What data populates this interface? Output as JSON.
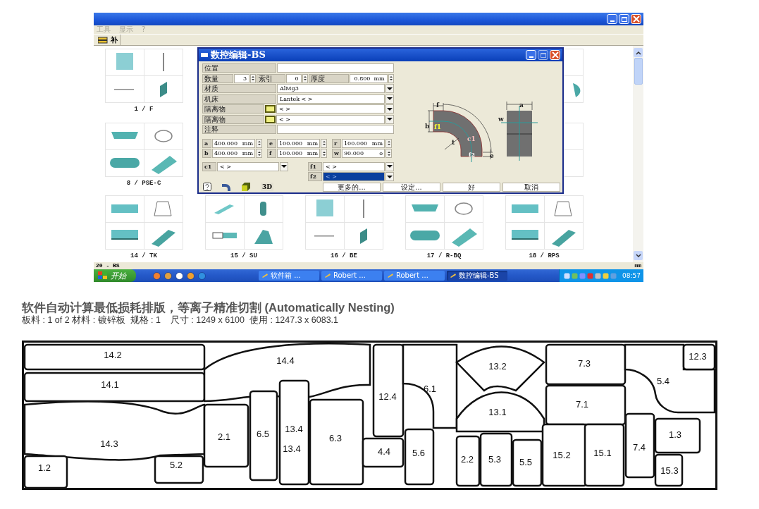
{
  "menu": [
    {
      "label": "工具",
      "disabled": true
    },
    {
      "label": "显示",
      "disabled": true
    },
    {
      "label": "?",
      "disabled": true
    }
  ],
  "toolbar": {
    "label": "补"
  },
  "cards": [
    {
      "label": "1 / F"
    },
    {
      "label": "8 / PSE-C"
    },
    {
      "label": "14 / TK"
    },
    {
      "label": "15 / SU"
    },
    {
      "label": "16 / BE"
    },
    {
      "label": "17 / R-BQ"
    },
    {
      "label": "18 / RPS"
    }
  ],
  "dialog": {
    "title": "数控编辑-BS",
    "rows": [
      {
        "kind": "text",
        "label": "位置"
      },
      {
        "kind": "counts",
        "items": [
          {
            "label": "数量",
            "value": "3"
          },
          {
            "label": "索引",
            "value": "0"
          },
          {
            "label": "厚度",
            "value": "0.800",
            "unit": "mm"
          }
        ]
      },
      {
        "kind": "select",
        "label": "材质",
        "value": "AlMg3"
      },
      {
        "kind": "select",
        "label": "机床",
        "value": "Lantek < >"
      },
      {
        "kind": "swatch",
        "label": "隔离物",
        "value": "< >"
      },
      {
        "kind": "swatch",
        "label": "隔离物",
        "value": "< >"
      },
      {
        "kind": "text",
        "label": "注释"
      }
    ],
    "dims": [
      [
        {
          "label": "a",
          "value": "400.000",
          "unit": "mm"
        },
        {
          "label": "e",
          "value": "100.000",
          "unit": "mm"
        },
        {
          "label": "r",
          "value": "100.000",
          "unit": "mm"
        }
      ],
      [
        {
          "label": "b",
          "value": "400.000",
          "unit": "mm"
        },
        {
          "label": "f",
          "value": "100.000",
          "unit": "mm"
        },
        {
          "label": "w",
          "value": "90.000",
          "unit": "o"
        }
      ]
    ],
    "c_select": {
      "label": "c1",
      "value": "< >"
    },
    "f_selects": [
      {
        "label": "f1",
        "value": "< >",
        "selected": false
      },
      {
        "label": "f2",
        "value": "< >",
        "selected": true
      }
    ],
    "diagram_labels": [
      "f",
      "w",
      "b",
      "f1",
      "c1",
      "t",
      "f2",
      "e",
      "a"
    ],
    "tool_text": "3D",
    "buttons": [
      "更多的...",
      "设定...",
      "好",
      "取消"
    ]
  },
  "status_bar": {
    "left": "20 - BS",
    "right": "mm"
  },
  "taskbar": {
    "start": "开始",
    "tasks": [
      {
        "label": "软件箱 ...",
        "selected": false
      },
      {
        "label": "Robert ...",
        "selected": false
      },
      {
        "label": "Robert ...",
        "selected": false
      },
      {
        "label": "数控编辑-BS",
        "selected": true
      }
    ],
    "clock": "08:57"
  },
  "caption": {
    "title": "软件自动计算最低损耗排版，等离子精准切割 (Automatically Nesting)",
    "subtitle": "板料 : 1 of 2 材料 : 镀锌板  规格 : 1    尺寸 : 1249 x 6100  使用 : 1247.3 x 6083.1"
  },
  "nesting": {
    "parts": [
      "14.2",
      "14.1",
      "14.4",
      "14.3",
      "1.2",
      "5.2",
      "2.1",
      "6.5",
      "13.4",
      "13.4",
      "6.3",
      "12.4",
      "4.4",
      "5.6",
      "6.1",
      "13.2",
      "13.1",
      "2.2",
      "5.3",
      "5.5",
      "7.3",
      "7.1",
      "15.2",
      "15.1",
      "7.4",
      "5.4",
      "12.3",
      "1.3",
      "15.3"
    ]
  }
}
